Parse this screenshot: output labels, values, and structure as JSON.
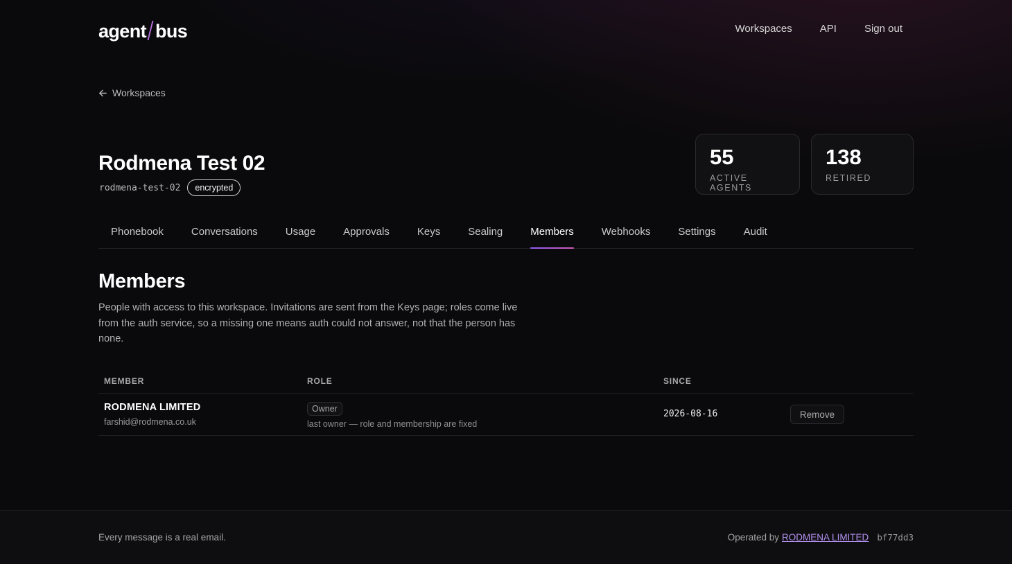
{
  "header": {
    "logo_left": "agent",
    "logo_right": "bus",
    "nav": [
      "Workspaces",
      "API",
      "Sign out"
    ]
  },
  "back_link": "Workspaces",
  "workspace": {
    "title": "Rodmena Test 02",
    "slug": "rodmena-test-02",
    "badge": "encrypted"
  },
  "stats": {
    "active": {
      "value": "55",
      "label": "ACTIVE AGENTS"
    },
    "retired": {
      "value": "138",
      "label": "RETIRED"
    }
  },
  "tabs": [
    "Phonebook",
    "Conversations",
    "Usage",
    "Approvals",
    "Keys",
    "Sealing",
    "Members",
    "Webhooks",
    "Settings",
    "Audit"
  ],
  "active_tab": "Members",
  "section": {
    "title": "Members",
    "description": "People with access to this workspace. Invitations are sent from the Keys page; roles come live from the auth service, so a missing one means auth could not answer, not that the person has none."
  },
  "table": {
    "headers": {
      "member": "MEMBER",
      "role": "ROLE",
      "since": "SINCE"
    },
    "rows": [
      {
        "name": "RODMENA LIMITED",
        "email": "farshid@rodmena.co.uk",
        "role": "Owner",
        "role_note": "last owner — role and membership are fixed",
        "since": "2026-08-16",
        "action": "Remove"
      }
    ]
  },
  "footer": {
    "tagline": "Every message is a real email.",
    "operated_by": "Operated by",
    "operator": "RODMENA LIMITED",
    "commit": "bf77dd3"
  },
  "colors": {
    "accent_purple": "#8f5cf7",
    "accent_pink": "#d45ab8",
    "link": "#b391f0",
    "background": "#0a0a0c"
  }
}
